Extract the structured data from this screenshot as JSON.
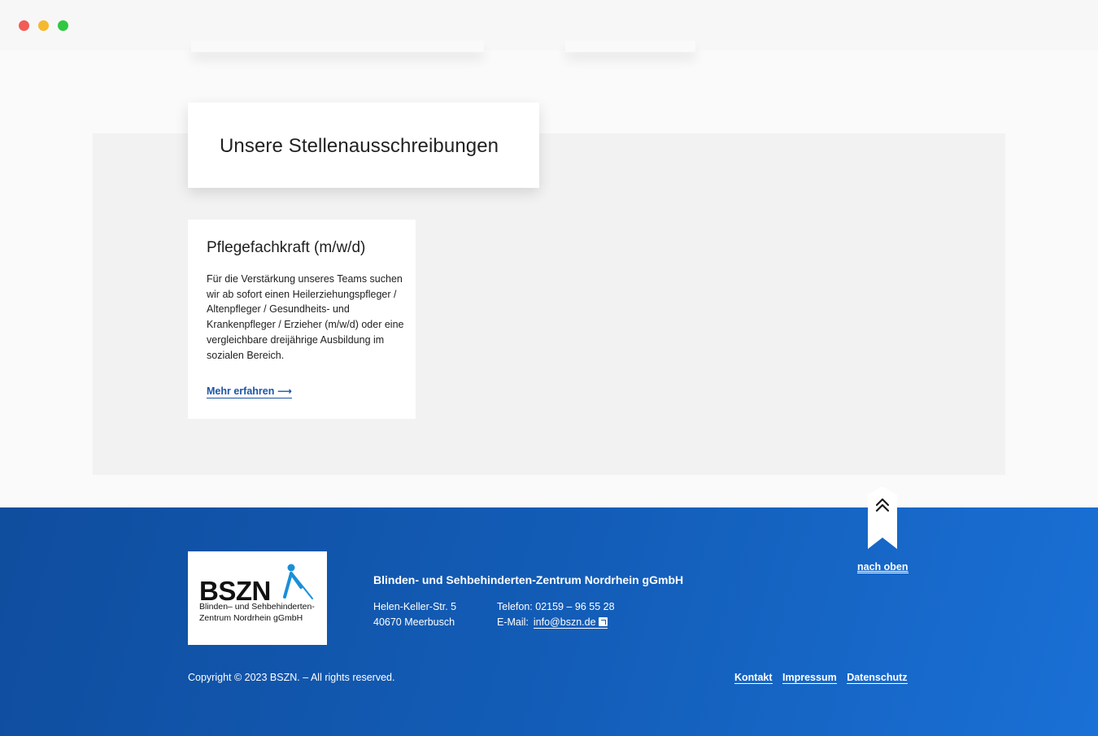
{
  "window": {
    "controls": [
      "close",
      "minimize",
      "maximize"
    ]
  },
  "jobs_section": {
    "heading": "Unsere Stellenausschreibungen",
    "cards": [
      {
        "title": "Pflegefachkraft (m/w/d)",
        "description": "Für die Verstärkung unseres Teams suchen wir ab sofort einen Heilerziehungspfleger / Altenpfleger / Gesundheits- und Krankenpfleger / Erzieher (m/w/d) oder eine vergleichbare dreijährige Ausbildung im sozialen Bereich.",
        "link_label": "Mehr erfahren ⟶"
      }
    ]
  },
  "back_to_top": {
    "label": "nach oben",
    "icon": "double-chevron-up-icon"
  },
  "footer": {
    "logo": {
      "wordmark": "BSZN",
      "subtitle": "Blinden– und Sehbehinderten-Zentrum Nordrhein gGmbH"
    },
    "org_name": "Blinden- und Sehbehinderten-Zentrum Nordrhein gGmbH",
    "address_line1": "Helen-Keller-Str. 5",
    "address_line2": "40670 Meerbusch",
    "phone": "Telefon: 02159 – 96 55 28",
    "email_label": "E-Mail:",
    "email": "info@bszn.de",
    "copyright": "Copyright © 2023 BSZN.  –  All rights reserved.",
    "links": [
      "Kontakt",
      "Impressum",
      "Datenschutz"
    ]
  },
  "colors": {
    "footer_start": "#0f4d9e",
    "footer_end": "#1a70d6",
    "link_blue": "#1c54a6",
    "section_bg": "#f2f2f2"
  }
}
